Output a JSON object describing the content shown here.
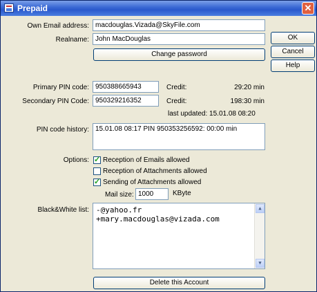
{
  "window": {
    "title": "Prepaid"
  },
  "account": {
    "email_label": "Own Email address:",
    "email_value": "macdouglas.Vizada@SkyFile.com",
    "realname_label": "Realname:",
    "realname_value": "John MacDouglas",
    "change_password_label": "Change password"
  },
  "pins": {
    "primary_label": "Primary PIN code:",
    "primary_value": "950388665943",
    "primary_credit_label": "Credit:",
    "primary_credit_value": "29:20 min",
    "secondary_label": "Secondary PIN Code:",
    "secondary_value": "950329216352",
    "secondary_credit_label": "Credit:",
    "secondary_credit_value": "198:30 min",
    "last_updated": "last updated: 15.01.08 08:20"
  },
  "history": {
    "label": "PIN code history:",
    "entry": "15.01.08 08:17 PIN 950353256592: 00:00 min"
  },
  "options": {
    "label": "Options:",
    "items": [
      {
        "label": "Reception of Emails allowed",
        "checked": true
      },
      {
        "label": "Reception of Attachments allowed",
        "checked": false
      },
      {
        "label": "Sending of Attachments allowed",
        "checked": true
      }
    ],
    "mail_size_label": "Mail size:",
    "mail_size_value": "1000",
    "mail_size_unit": "KByte"
  },
  "bwlist": {
    "label": "Black&White list:",
    "lines": [
      "-@yahoo.fr",
      "+mary.macdouglas@vizada.com"
    ]
  },
  "delete_label": "Delete this Account",
  "buttons": {
    "ok": "OK",
    "cancel": "Cancel",
    "help": "Help"
  },
  "colors": {
    "titlebar": "#2a59cc",
    "dialog_bg": "#ece9d8",
    "check": "#21a121"
  }
}
